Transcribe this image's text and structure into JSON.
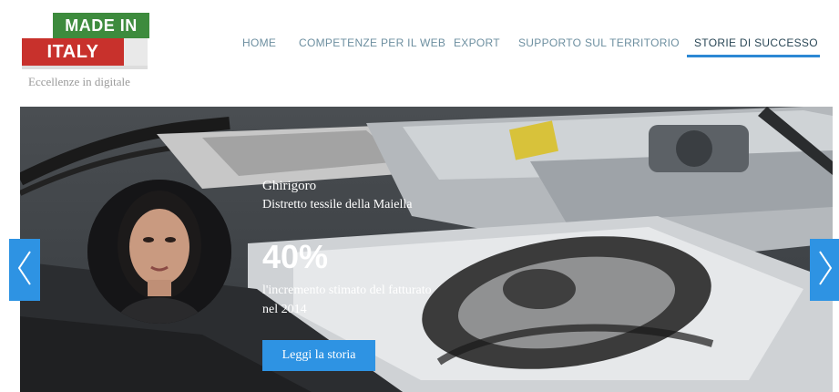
{
  "logo": {
    "line1": "MADE IN",
    "line2": "ITALY",
    "tagline": "Eccellenze in digitale",
    "colors": {
      "green": "#3d8b3d",
      "red": "#c8312c",
      "white": "#e9e9e9"
    }
  },
  "nav": {
    "items": [
      {
        "label": "HOME"
      },
      {
        "label": "COMPETENZE PER IL WEB"
      },
      {
        "label": "EXPORT"
      },
      {
        "label": "SUPPORTO SUL TERRITORIO"
      },
      {
        "label": "STORIE DI SUCCESSO",
        "active": true
      }
    ],
    "active_color": "#2c88d4"
  },
  "slide": {
    "company": "Ghirigoro",
    "district": "Distretto tessile della Maiella",
    "value": "40%",
    "description": "l'incremento stimato del fatturato nel 2014",
    "cta_label": "Leggi la storia"
  },
  "carousel": {
    "prev_icon": "chevron-left-icon",
    "next_icon": "chevron-right-icon",
    "accent": "#2e93e3"
  }
}
